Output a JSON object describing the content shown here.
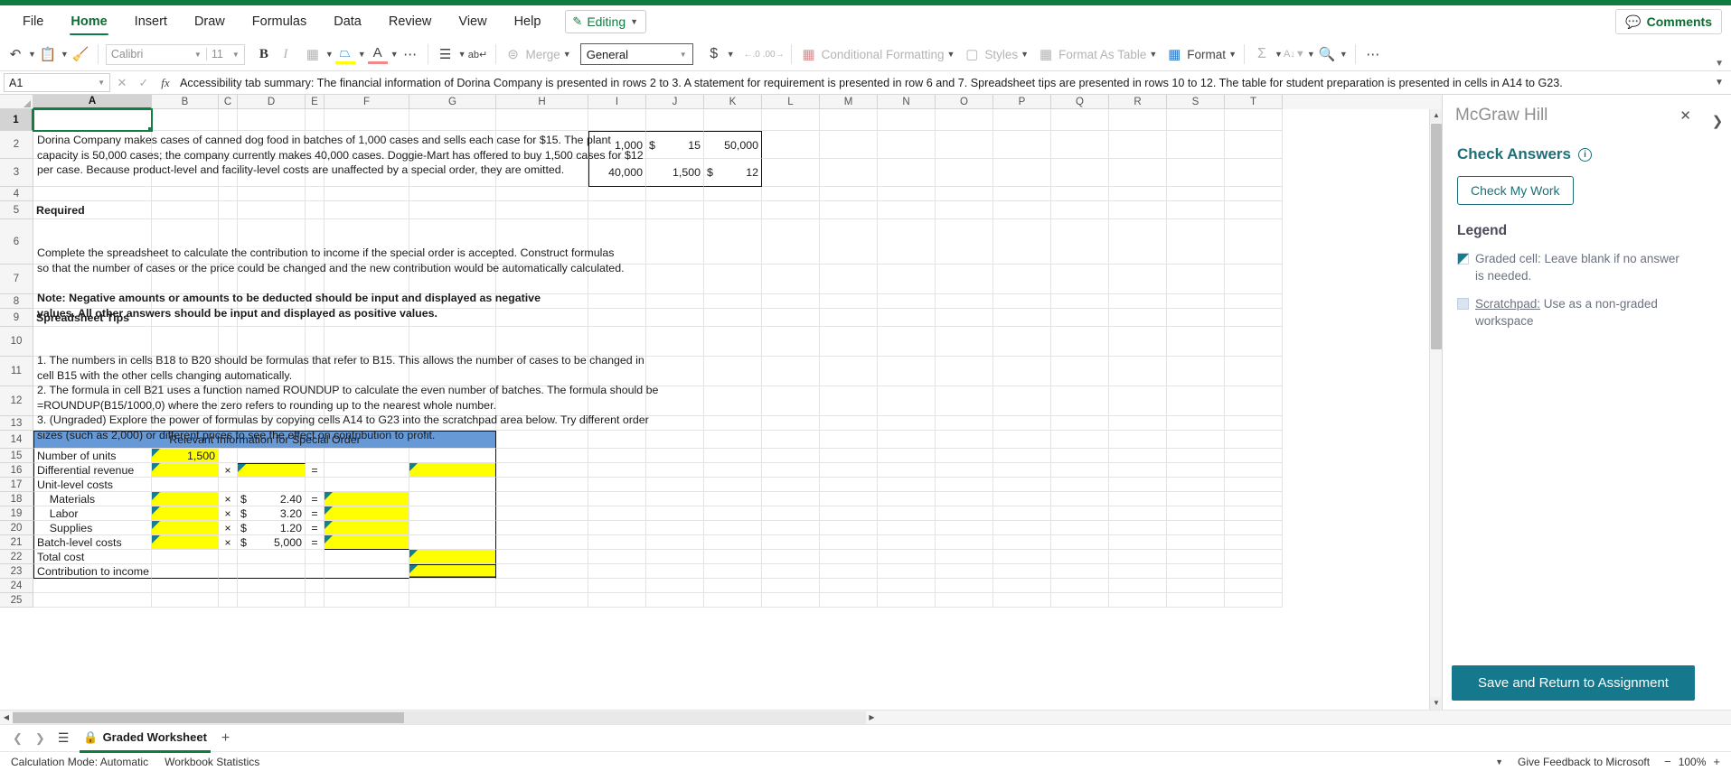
{
  "ribbon": {
    "tabs": [
      {
        "label": "File",
        "active": false
      },
      {
        "label": "Home",
        "active": true
      },
      {
        "label": "Insert",
        "active": false
      },
      {
        "label": "Draw",
        "active": false
      },
      {
        "label": "Formulas",
        "active": false
      },
      {
        "label": "Data",
        "active": false
      },
      {
        "label": "Review",
        "active": false
      },
      {
        "label": "View",
        "active": false
      },
      {
        "label": "Help",
        "active": false
      }
    ],
    "editing_label": "Editing",
    "comments_label": "Comments",
    "font_name": "Calibri",
    "font_size": "11",
    "number_format": "General",
    "merge_label": "Merge",
    "conditional_formatting_label": "Conditional Formatting",
    "styles_label": "Styles",
    "format_as_table_label": "Format As Table",
    "format_label": "Format",
    "accent_green": "#107c41",
    "accent_teal": "#15788c"
  },
  "formula_bar": {
    "name_box": "A1",
    "content": "Accessibility tab summary: The financial information of Dorina Company is presented in rows 2 to 3. A statement for requirement is presented in row 6 and 7. Spreadsheet tips are presented in rows 10 to 12. The table for student preparation is presented in cells in A14 to G23."
  },
  "grid": {
    "columns": [
      "A",
      "B",
      "C",
      "D",
      "E",
      "F",
      "G",
      "H",
      "I",
      "J",
      "K",
      "L",
      "M",
      "N",
      "O",
      "P",
      "Q",
      "R",
      "S",
      "T"
    ],
    "selected_column": "A",
    "selected_row": "1",
    "rows": [
      "1",
      "2",
      "3",
      "4",
      "5",
      "6",
      "7",
      "8",
      "9",
      "10",
      "11",
      "12",
      "13",
      "14",
      "15",
      "16",
      "17",
      "18",
      "19",
      "20",
      "21",
      "22",
      "23",
      "24",
      "25"
    ],
    "text_blocks": {
      "intro": "Dorina Company makes cases of canned dog food in batches of 1,000 cases and sells each case for $15. The plant capacity is 50,000 cases; the company currently makes 40,000 cases. Doggie-Mart has offered to buy 1,500 cases for $12 per case. Because product-level and facility-level costs are unaffected by a special order, they are omitted.",
      "required_heading": "Required",
      "required_body": "Complete the spreadsheet to calculate the contribution to income if the special order is accepted. Construct formulas so that the number of cases or the price could be changed and the new contribution would be automatically calculated.",
      "note": "Note: Negative amounts or amounts to be deducted should be input and displayed as negative values. All other answers should be input and displayed as positive values.",
      "tips_heading": "Spreadsheet Tips",
      "tip1": "1. The numbers in cells B18 to B20 should be formulas that refer to B15. This allows the number of cases to be changed in cell B15 with the other cells changing automatically.",
      "tip2": "2. The formula in cell B21 uses a function named ROUNDUP to calculate the even number of batches. The formula should be =ROUNDUP(B15/1000,0) where the zero refers to rounding up to the nearest whole number.",
      "tip3": "3. (Ungraded) Explore the power of formulas by copying cells A14 to G23 into the scratchpad area below. Try different order sizes (such as 2,000) or different prices to see the effect on contribution to profit."
    },
    "data_cells": {
      "i2": "1,000",
      "j2_sym": "$",
      "j2": "15",
      "k2": "50,000",
      "i3": "40,000",
      "j3": "1,500",
      "k3_sym": "$",
      "k3": "12"
    },
    "table": {
      "header": "Relevant Information for Special Order",
      "rows": [
        {
          "row": "15",
          "label": "Number of units",
          "b": "1,500",
          "op": "",
          "d_sym": "",
          "d": "",
          "eq": "",
          "f": "",
          "g": "",
          "b_yellow": true,
          "d_yellow": false,
          "f_yellow": false,
          "g_yellow": false
        },
        {
          "row": "16",
          "label": "Differential revenue",
          "b": "",
          "op": "×",
          "d_sym": "",
          "d": "",
          "eq": "=",
          "f": "",
          "g": "",
          "b_yellow": true,
          "d_yellow": true,
          "f_yellow": false,
          "g_yellow": true
        },
        {
          "row": "17",
          "label": "Unit-level costs",
          "b": "",
          "op": "",
          "d_sym": "",
          "d": "",
          "eq": "",
          "f": "",
          "g": "",
          "b_yellow": false,
          "d_yellow": false,
          "f_yellow": false,
          "g_yellow": false
        },
        {
          "row": "18",
          "label": "    Materials",
          "b": "",
          "op": "×",
          "d_sym": "$",
          "d": "2.40",
          "eq": "=",
          "f": "",
          "g": "",
          "b_yellow": true,
          "d_yellow": false,
          "f_yellow": true,
          "g_yellow": false
        },
        {
          "row": "19",
          "label": "    Labor",
          "b": "",
          "op": "×",
          "d_sym": "$",
          "d": "3.20",
          "eq": "=",
          "f": "",
          "g": "",
          "b_yellow": true,
          "d_yellow": false,
          "f_yellow": true,
          "g_yellow": false
        },
        {
          "row": "20",
          "label": "    Supplies",
          "b": "",
          "op": "×",
          "d_sym": "$",
          "d": "1.20",
          "eq": "=",
          "f": "",
          "g": "",
          "b_yellow": true,
          "d_yellow": false,
          "f_yellow": true,
          "g_yellow": false
        },
        {
          "row": "21",
          "label": "Batch-level costs",
          "b": "",
          "op": "×",
          "d_sym": "$",
          "d": "5,000",
          "eq": "=",
          "f": "",
          "g": "",
          "b_yellow": true,
          "d_yellow": false,
          "f_yellow": true,
          "g_yellow": false
        },
        {
          "row": "22",
          "label": "Total cost",
          "b": "",
          "op": "",
          "d_sym": "",
          "d": "",
          "eq": "",
          "f": "",
          "g": "",
          "b_yellow": false,
          "d_yellow": false,
          "f_yellow": false,
          "g_yellow": true
        },
        {
          "row": "23",
          "label": "Contribution to income",
          "b": "",
          "op": "",
          "d_sym": "",
          "d": "",
          "eq": "",
          "f": "",
          "g": "",
          "b_yellow": false,
          "d_yellow": false,
          "f_yellow": false,
          "g_yellow": true
        }
      ]
    }
  },
  "sheet_bar": {
    "sheet_name": "Graded Worksheet",
    "add_sheet_label": "+"
  },
  "status_bar": {
    "calculation_mode": "Calculation Mode: Automatic",
    "workbook_statistics": "Workbook Statistics",
    "feedback": "Give Feedback to Microsoft",
    "zoom": "100%"
  },
  "pane": {
    "title": "McGraw Hill",
    "heading": "Check Answers",
    "check_button": "Check My Work",
    "legend_heading": "Legend",
    "legend_graded": "Graded cell: Leave blank if no answer is needed.",
    "legend_scratchpad_link": "Scratchpad:",
    "legend_scratchpad_rest": " Use as a non-graded workspace",
    "save_button": "Save and Return to Assignment"
  }
}
